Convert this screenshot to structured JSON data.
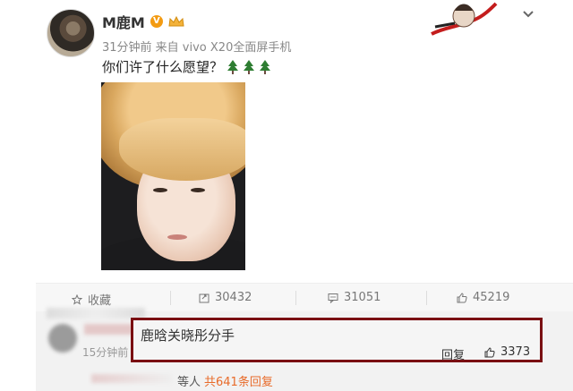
{
  "post": {
    "username": "M鹿M",
    "verified_badge": "V",
    "meta": "31分钟前 来自 vivo X20全面屏手机",
    "content": "你们许了什么愿望？",
    "emojis": [
      "tree-icon",
      "tree-icon",
      "tree-icon"
    ]
  },
  "actions": {
    "favorite": "收藏",
    "repost": "30432",
    "comment": "31051",
    "like": "45219"
  },
  "comment": {
    "time": "15分钟前",
    "text": "鹿晗关晓彤分手",
    "reply_label": "回复",
    "likes": "3373"
  },
  "replies_summary": {
    "prefix": "等人",
    "count_text": "共641条回复"
  },
  "colors": {
    "highlight_border": "#7a0f12",
    "badge": "#f39b12",
    "link": "#e86b2a"
  }
}
